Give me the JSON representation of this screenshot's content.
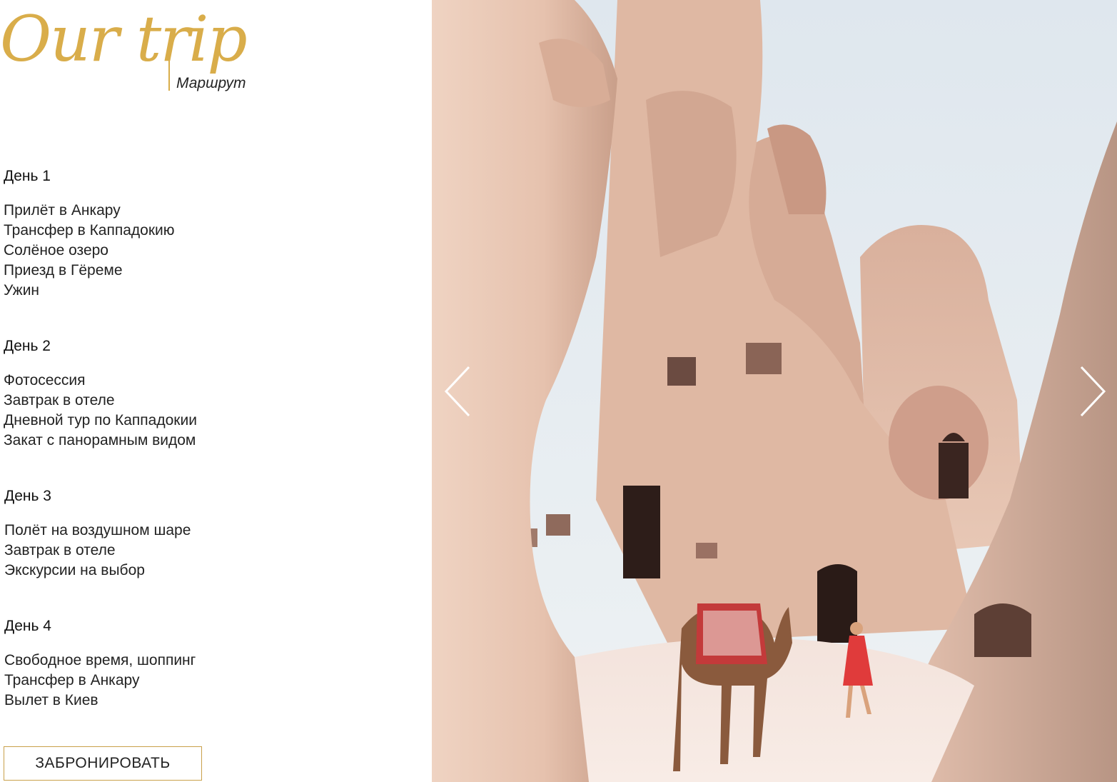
{
  "header": {
    "title": "Our trip",
    "subtitle": "Маршрут"
  },
  "days": [
    {
      "title": "День 1",
      "items": [
        "Прилёт в Анкару",
        "Трансфер в Каппадокию",
        "Солёное озеро",
        "Приезд в Гёреме",
        "Ужин"
      ]
    },
    {
      "title": "День 2",
      "items": [
        "Фотосессия",
        "Завтрак в отеле",
        "Дневной тур по Каппадокии",
        "Закат с панорамным видом"
      ]
    },
    {
      "title": "День 3",
      "items": [
        "Полёт на воздушном шаре",
        "Завтрак в отеле",
        "Экскурсии на выбор"
      ]
    },
    {
      "title": "День 4",
      "items": [
        "Свободное время, шоппинг",
        "Трансфер в Анкару",
        "Вылет в Киев"
      ]
    }
  ],
  "book_button": {
    "label": "ЗАБРОНИРОВАТЬ"
  },
  "slider": {
    "prev_icon": "chevron-left-icon",
    "next_icon": "chevron-right-icon"
  },
  "colors": {
    "accent_gold": "#d9ad4a",
    "button_border": "#c9a04a",
    "text": "#222222",
    "rock": "#e9c9b6",
    "sky": "#e6ecf0"
  }
}
